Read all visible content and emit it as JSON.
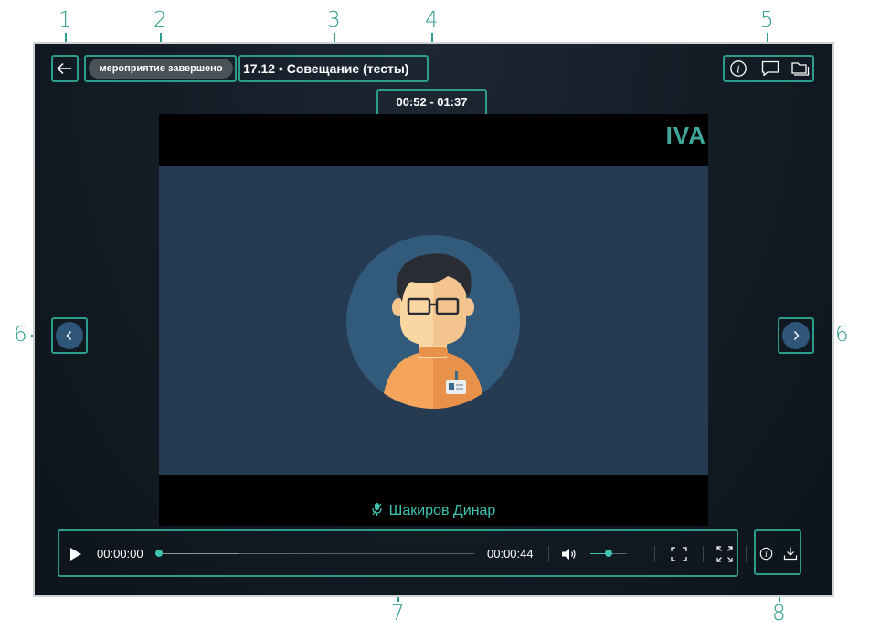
{
  "callouts": [
    "1",
    "2",
    "3",
    "4",
    "5",
    "6",
    "6",
    "7",
    "8"
  ],
  "header": {
    "status_badge": "мероприятие завершено",
    "title": "17.12 • Совещание (тесты)",
    "time_range": "00:52 - 01:37"
  },
  "video": {
    "logo": "IVA",
    "speaker_name": "Шакиров Динар"
  },
  "player": {
    "current_time": "00:00:00",
    "duration": "00:00:44",
    "progress_fraction": 0.0,
    "volume_fraction": 0.5
  },
  "icons": {
    "back": "arrow-left-icon",
    "info": "info-icon",
    "chat": "chat-icon",
    "files": "folder-icon",
    "prev": "chevron-left-icon",
    "next": "chevron-right-icon",
    "play": "play-icon",
    "volume": "volume-icon",
    "fullscreen": "fullscreen-icon",
    "expand": "expand-icon",
    "download": "download-icon",
    "mic": "microphone-icon"
  },
  "colors": {
    "accent": "#2e9c8c",
    "speaker": "#3ec3b0",
    "badge_bg": "#4a5258",
    "nav_button": "#2f5578"
  }
}
